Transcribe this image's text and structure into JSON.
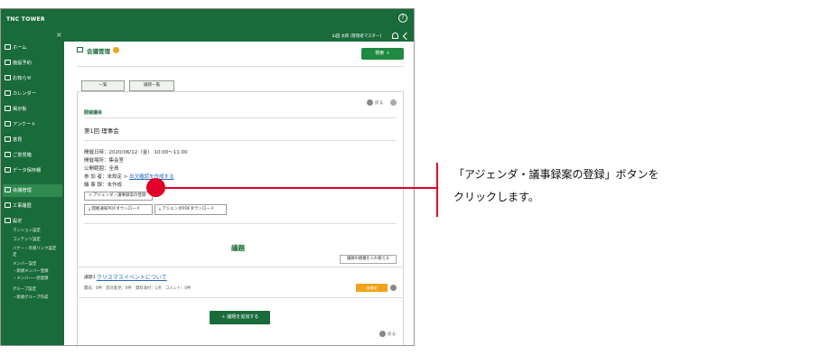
{
  "app": {
    "brand": "TNC TOWER"
  },
  "user": {
    "name": "山田 太郎 [管理者マスター]"
  },
  "sidebar": {
    "close": "×",
    "items": [
      {
        "label": "ホーム"
      },
      {
        "label": "施設予約"
      },
      {
        "label": "お知らせ"
      },
      {
        "label": "カレンダー"
      },
      {
        "label": "掲示板"
      },
      {
        "label": "アンケート"
      },
      {
        "label": "意見"
      },
      {
        "label": "ご意見箱"
      },
      {
        "label": "データ保存棚"
      },
      {
        "label": "会議管理"
      },
      {
        "label": "工事履歴"
      },
      {
        "label": "設定"
      }
    ],
    "sub_items": [
      {
        "label": "マンション設定"
      },
      {
        "label": "コンテンツ設定"
      },
      {
        "label": "バナー・外部リンク設定"
      },
      {
        "label": "定"
      },
      {
        "label": "メンバー設定"
      },
      {
        "label": "・新規メンバー登録"
      },
      {
        "label": "・メンバー一括登録"
      },
      {
        "label": "グループ設定"
      },
      {
        "label": "・新規グループ作成"
      }
    ]
  },
  "header": {
    "page_title": "会議管理",
    "search_button": "検索 ＋"
  },
  "tabs": [
    {
      "label": "一覧"
    },
    {
      "label": "議題一覧"
    }
  ],
  "panel": {
    "back_label": "戻る",
    "section": "開催議会",
    "meeting_name": "第1回 理事会",
    "info": {
      "date": "開催日時：2020/06/12（金） 10:00～11:00",
      "place": "開催場所：集会室",
      "scope": "公開範囲：全員",
      "attendance_prefix": "参 加 者：未設定 > ",
      "attendance_link": "出欠確認を作成する",
      "minutes": "議 事 録：未作成"
    },
    "agenda_button": "> アジェンダ・議事録案の登録",
    "download_buttons": [
      {
        "label": "開催通知PDFダウンロード"
      },
      {
        "label": "アジェンダPDFダウンロード"
      }
    ]
  },
  "agenda": {
    "title": "議題",
    "reorder_button": "議題の順番を入れ替える",
    "items": [
      {
        "no": "議題1",
        "title": "クリスマスイベントについて",
        "meta": "賛成：0件　反対意見：0件　資料添付：1点　コメント：0件",
        "status": "未確定"
      }
    ],
    "add_button": "＋ 議題を追加する",
    "back_label": "戻る"
  },
  "callout": {
    "line1": "「アジェンダ・議事録案の登録」ボタンを",
    "line2": "クリックします。",
    "color": "#e0002a"
  },
  "colors": {
    "brand_green": "#1a6b3a",
    "accent_orange": "#f2a31a",
    "link_blue": "#2266bb"
  }
}
